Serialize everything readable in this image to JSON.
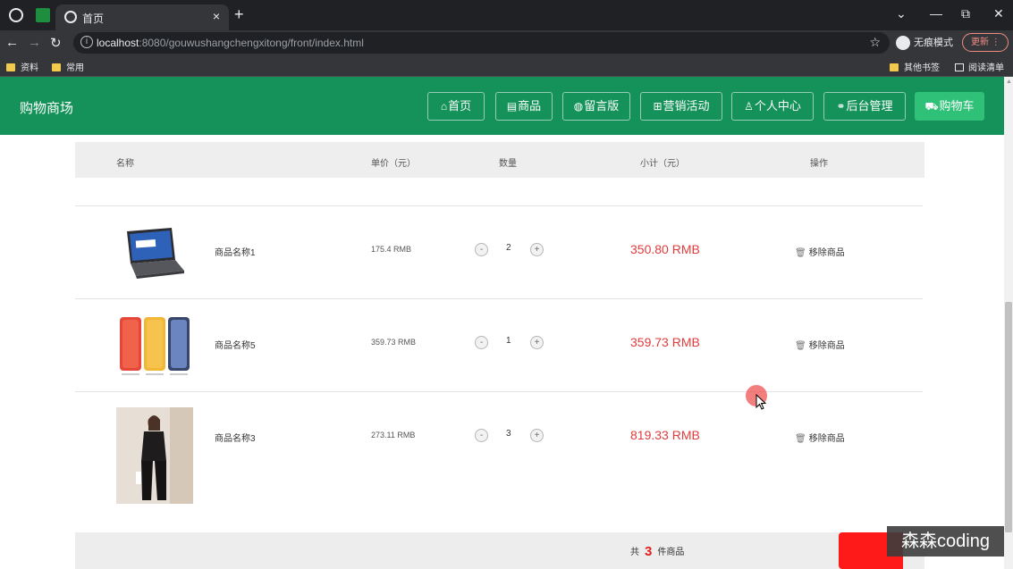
{
  "browser": {
    "tab_title": "首页",
    "tab_close": "×",
    "new_tab": "+",
    "url_host": "localhost",
    "url_rest": ":8080/gouwushangchengxitong/front/index.html",
    "incognito_label": "无痕模式",
    "update_label": "更新",
    "bookmarks": [
      "资料",
      "常用"
    ],
    "bookmarks_right": [
      "其他书签",
      "阅读清单"
    ],
    "window_controls": [
      "⌄",
      "—",
      "⧉",
      "✕"
    ]
  },
  "site": {
    "title": "购物商场",
    "nav": [
      {
        "icon": "home-icon",
        "label": "首页"
      },
      {
        "icon": "calendar-icon",
        "label": "商品"
      },
      {
        "icon": "globe-icon",
        "label": "留言版"
      },
      {
        "icon": "gift-icon",
        "label": "营销活动"
      },
      {
        "icon": "user-icon",
        "label": "个人中心"
      },
      {
        "icon": "link-icon",
        "label": "后台管理"
      },
      {
        "icon": "cart-icon",
        "label": "购物车"
      }
    ]
  },
  "cart": {
    "headers": {
      "name": "名称",
      "unit_price": "单价（元）",
      "quantity": "数量",
      "subtotal": "小计（元）",
      "action": "操作"
    },
    "items": [
      {
        "name": "商品名称1",
        "price": "175.4 RMB",
        "qty": "2",
        "subtotal": "350.80 RMB",
        "image": "laptop-image"
      },
      {
        "name": "商品名称5",
        "price": "359.73 RMB",
        "qty": "1",
        "subtotal": "359.73 RMB",
        "image": "phones-image"
      },
      {
        "name": "商品名称3",
        "price": "273.11 RMB",
        "qty": "3",
        "subtotal": "819.33 RMB",
        "image": "suit-model-image"
      }
    ],
    "remove_label": "移除商品",
    "minus_label": "-",
    "plus_label": "+",
    "footer": {
      "prefix": "共",
      "count": "3",
      "suffix": "件商品"
    }
  },
  "watermark": "森森coding",
  "colors": {
    "header_green": "#149259",
    "cart_button": "#2fc178",
    "price_red": "#e03c3c"
  }
}
